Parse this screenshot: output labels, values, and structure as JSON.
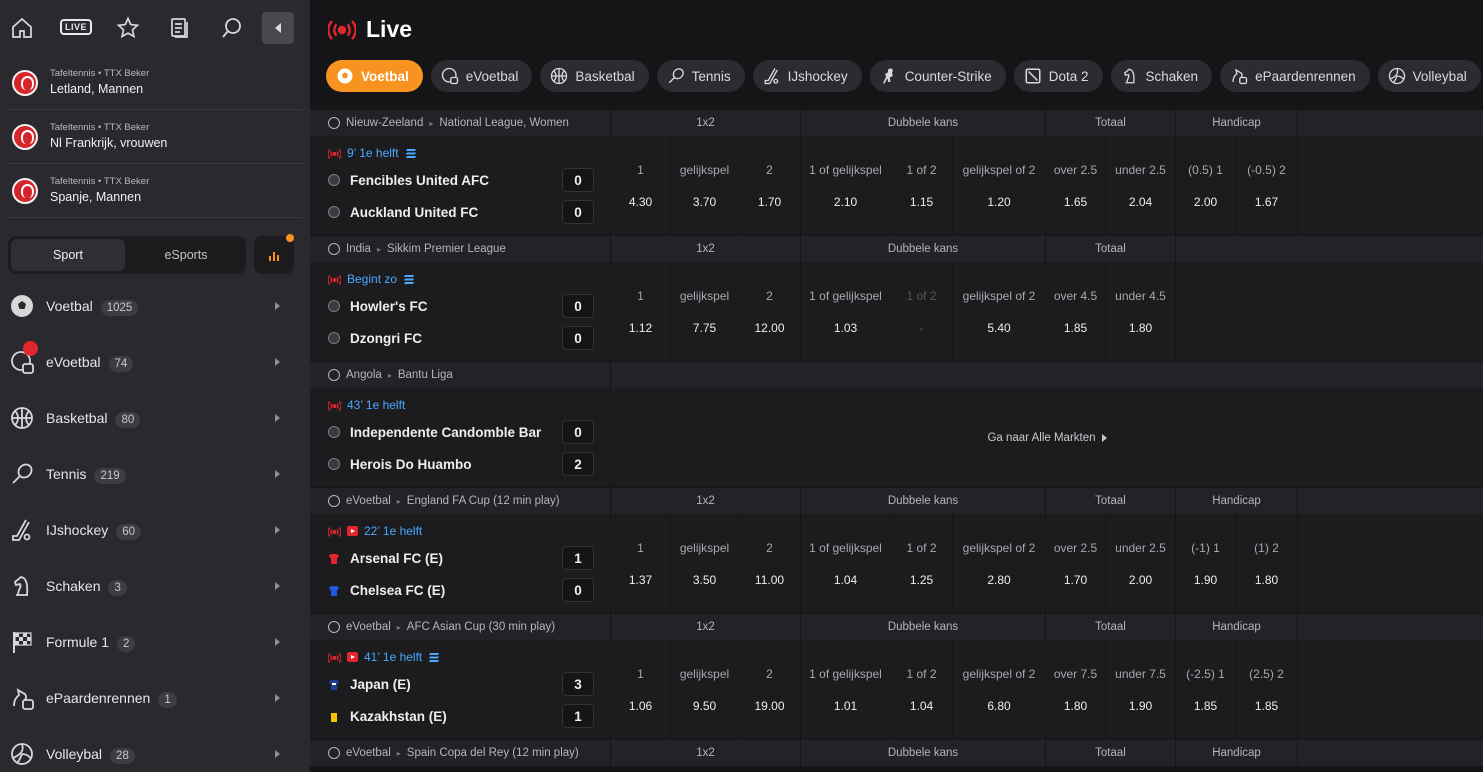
{
  "topbar": {
    "live_label": "LIVE"
  },
  "favorites": [
    {
      "category": "Tafeltennis • TTX Beker",
      "name": "Letland, Mannen"
    },
    {
      "category": "Tafeltennis • TTX Beker",
      "name": "Nl Frankrijk, vrouwen"
    },
    {
      "category": "Tafeltennis • TTX Beker",
      "name": "Spanje, Mannen"
    }
  ],
  "switch": {
    "sport": "Sport",
    "esports": "eSports"
  },
  "colors": {
    "accent": "#f7931e",
    "live_red": "#e2262d",
    "link_blue": "#4aa8ff"
  },
  "sports": [
    {
      "name": "Voetbal",
      "count": "1025",
      "icon": "soccer-ball-icon"
    },
    {
      "name": "eVoetbal",
      "count": "74",
      "icon": "esoccer-icon"
    },
    {
      "name": "Basketbal",
      "count": "80",
      "icon": "basketball-icon"
    },
    {
      "name": "Tennis",
      "count": "219",
      "icon": "tennis-icon"
    },
    {
      "name": "IJshockey",
      "count": "60",
      "icon": "ice-hockey-icon"
    },
    {
      "name": "Schaken",
      "count": "3",
      "icon": "chess-knight-icon"
    },
    {
      "name": "Formule 1",
      "count": "2",
      "icon": "checkered-flag-icon"
    },
    {
      "name": "ePaardenrennen",
      "count": "1",
      "icon": "horse-racing-icon"
    },
    {
      "name": "Volleybal",
      "count": "28",
      "icon": "volleyball-icon"
    }
  ],
  "main": {
    "title": "Live"
  },
  "chips": [
    {
      "label": "Voetbal",
      "active": true
    },
    {
      "label": "eVoetbal"
    },
    {
      "label": "Basketbal"
    },
    {
      "label": "Tennis"
    },
    {
      "label": "IJshockey"
    },
    {
      "label": "Counter-Strike"
    },
    {
      "label": "Dota 2"
    },
    {
      "label": "Schaken"
    },
    {
      "label": "ePaardenrennen"
    },
    {
      "label": "Volleybal"
    }
  ],
  "markets": {
    "m1x2": "1x2",
    "dubbele": "Dubbele kans",
    "totaal": "Totaal",
    "handicap": "Handicap"
  },
  "events": [
    {
      "league_a": "Nieuw-Zeeland",
      "league_b": "National League, Women",
      "time": "9’ 1e helft",
      "home": "Fencibles United AFC",
      "home_score": "0",
      "away": "Auckland United FC",
      "away_score": "0",
      "odds": [
        {
          "l": "1",
          "v": "4.30"
        },
        {
          "l": "gelijkspel",
          "v": "3.70"
        },
        {
          "l": "2",
          "v": "1.70"
        },
        {
          "l": "1 of gelijkspel",
          "v": "2.10"
        },
        {
          "l": "1 of 2",
          "v": "1.15"
        },
        {
          "l": "gelijkspel of 2",
          "v": "1.20"
        },
        {
          "l": "over 2.5",
          "v": "1.65"
        },
        {
          "l": "under 2.5",
          "v": "2.04"
        },
        {
          "l": "(0.5) 1",
          "v": "2.00"
        },
        {
          "l": "(-0.5) 2",
          "v": "1.67"
        }
      ]
    },
    {
      "league_a": "India",
      "league_b": "Sikkim Premier League",
      "time": "Begint zo",
      "home": "Howler's FC",
      "home_score": "0",
      "away": "Dzongri FC",
      "away_score": "0",
      "odds": [
        {
          "l": "1",
          "v": "1.12"
        },
        {
          "l": "gelijkspel",
          "v": "7.75"
        },
        {
          "l": "2",
          "v": "12.00"
        },
        {
          "l": "1 of gelijkspel",
          "v": "1.03"
        },
        {
          "l": "1 of 2",
          "v": "-"
        },
        {
          "l": "gelijkspel of 2",
          "v": "5.40"
        },
        {
          "l": "over 4.5",
          "v": "1.85"
        },
        {
          "l": "under 4.5",
          "v": "1.80"
        }
      ]
    },
    {
      "league_a": "Angola",
      "league_b": "Bantu Liga",
      "time": "43’ 1e helft",
      "home": "Independente Candomble Bar",
      "home_score": "0",
      "away": "Herois Do Huambo",
      "away_score": "2",
      "goto": "Ga naar Alle Markten"
    },
    {
      "league_a": "eVoetbal",
      "league_b": "England FA Cup (12 min play)",
      "time": "22’ 1e helft",
      "home": "Arsenal FC (E)",
      "home_score": "1",
      "away": "Chelsea FC (E)",
      "away_score": "0",
      "odds": [
        {
          "l": "1",
          "v": "1.37"
        },
        {
          "l": "gelijkspel",
          "v": "3.50"
        },
        {
          "l": "2",
          "v": "11.00"
        },
        {
          "l": "1 of gelijkspel",
          "v": "1.04"
        },
        {
          "l": "1 of 2",
          "v": "1.25"
        },
        {
          "l": "gelijkspel of 2",
          "v": "2.80"
        },
        {
          "l": "over 2.5",
          "v": "1.70"
        },
        {
          "l": "under 2.5",
          "v": "2.00"
        },
        {
          "l": "(-1) 1",
          "v": "1.90"
        },
        {
          "l": "(1) 2",
          "v": "1.80"
        }
      ]
    },
    {
      "league_a": "eVoetbal",
      "league_b": "AFC Asian Cup (30 min play)",
      "time": "41’ 1e helft",
      "home": "Japan (E)",
      "home_score": "3",
      "away": "Kazakhstan (E)",
      "away_score": "1",
      "odds": [
        {
          "l": "1",
          "v": "1.06"
        },
        {
          "l": "gelijkspel",
          "v": "9.50"
        },
        {
          "l": "2",
          "v": "19.00"
        },
        {
          "l": "1 of gelijkspel",
          "v": "1.01"
        },
        {
          "l": "1 of 2",
          "v": "1.04"
        },
        {
          "l": "gelijkspel of 2",
          "v": "6.80"
        },
        {
          "l": "over 7.5",
          "v": "1.80"
        },
        {
          "l": "under 7.5",
          "v": "1.90"
        },
        {
          "l": "(-2.5) 1",
          "v": "1.85"
        },
        {
          "l": "(2.5) 2",
          "v": "1.85"
        }
      ]
    },
    {
      "league_a": "eVoetbal",
      "league_b": "Spain Copa del Rey (12 min play)"
    }
  ]
}
